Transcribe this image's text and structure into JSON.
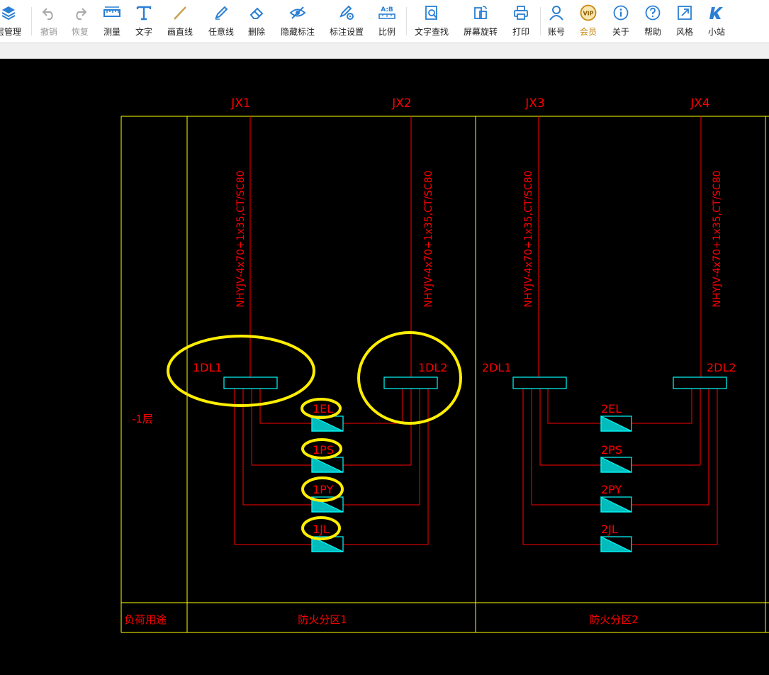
{
  "toolbar": {
    "layer_manage": "层管理",
    "undo": "撤销",
    "redo": "恢复",
    "measure": "测量",
    "text": "文字",
    "draw_line": "画直线",
    "freehand_line": "任意线",
    "delete": "删除",
    "hide_marks": "隐藏标注",
    "mark_settings": "标注设置",
    "scale": "比例",
    "scale_icon_text": "A:B",
    "find_text": "文字查找",
    "rotate_screen": "屏幕旋转",
    "print": "打印",
    "account": "账号",
    "member": "会员",
    "vip_badge": "VIP",
    "about": "关于",
    "help": "帮助",
    "style": "风格",
    "mini_site": "小站",
    "accent_color": "#2a7fd4",
    "vip_color": "#c8860f"
  },
  "drawing": {
    "columns": [
      "JX1",
      "JX2",
      "JX3",
      "JX4"
    ],
    "cable_spec": "NHYJV-4x70+1x35,CT/SC80",
    "distribution_boxes": [
      "1DL1",
      "1DL2",
      "2DL1",
      "2DL2"
    ],
    "zone1_loads": [
      "1EL",
      "1PS",
      "1PY",
      "1JL"
    ],
    "zone2_loads": [
      "2EL",
      "2PS",
      "2PY",
      "2JL"
    ],
    "floor_label": "-1层",
    "row_label": "负荷用途",
    "zone1_label": "防火分区1",
    "zone2_label": "防火分区2",
    "frame_color": "#ffff00",
    "wire_color": "#ff0000",
    "box_color": "#00ffff",
    "highlight_color": "#ffff00"
  }
}
